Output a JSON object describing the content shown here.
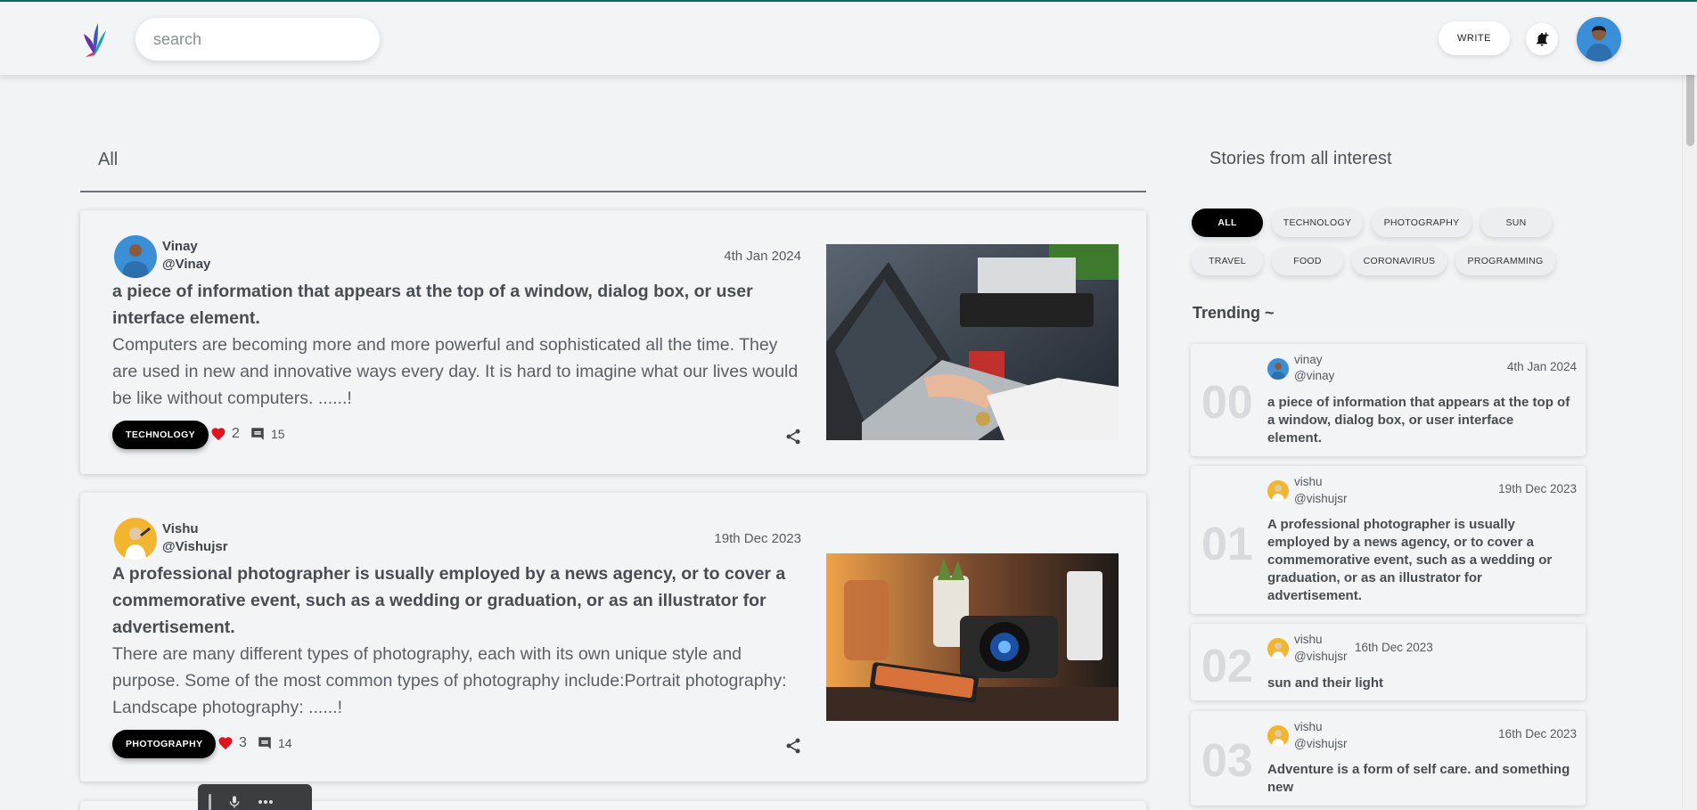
{
  "header": {
    "search_placeholder": "search",
    "write_label": "WRITE"
  },
  "feed": {
    "tab_label": "All",
    "posts": [
      {
        "author_name": "Vinay",
        "author_handle": "@Vinay",
        "date": "4th Jan 2024",
        "title": "a piece of information that appears at the top of a window, dialog box, or user interface element.",
        "excerpt": "Computers are becoming more and more powerful and sophisticated all the time. They are used in new and innovative ways every day. It is hard to imagine what our lives would be like without computers. ......!",
        "tag": "TECHNOLOGY",
        "likes": "2",
        "comments": "15"
      },
      {
        "author_name": "Vishu",
        "author_handle": "@Vishujsr",
        "date": "19th Dec 2023",
        "title": "A professional photographer is usually employed by a news agency, or to cover a commemorative event, such as a wedding or graduation, or as an illustrator for advertisement.",
        "excerpt": "There are many different types of photography, each with its own unique style and purpose. Some of the most common types of photography include:Portrait photography: Landscape photography: ......!",
        "tag": "PHOTOGRAPHY",
        "likes": "3",
        "comments": "14"
      }
    ]
  },
  "sidebar": {
    "title": "Stories from all interest",
    "chips": [
      "ALL",
      "TECHNOLOGY",
      "PHOTOGRAPHY",
      "SUN",
      "TRAVEL",
      "FOOD",
      "CORONAVIRUS",
      "PROGRAMMING"
    ],
    "active_chip": "ALL",
    "trending_label": "Trending ~",
    "trending": [
      {
        "rank": "00",
        "name": "vinay",
        "handle": "@vinay",
        "date": "4th Jan 2024",
        "title": "a piece of information that appears at the top of a window, dialog box, or user interface element."
      },
      {
        "rank": "01",
        "name": "vishu",
        "handle": "@vishujsr",
        "date": "19th Dec 2023",
        "title": "A professional photographer is usually employed by a news agency, or to cover a commemorative event, such as a wedding or graduation, or as an illustrator for advertisement."
      },
      {
        "rank": "02",
        "name": "vishu",
        "handle": "@vishujsr",
        "date": "16th Dec 2023",
        "title": "sun and their light"
      },
      {
        "rank": "03",
        "name": "vishu",
        "handle": "@vishujsr",
        "date": "16th Dec 2023",
        "title": "Adventure is a form of self care. and something new"
      }
    ]
  },
  "colors": {
    "accent_top_border": "#0e6b6b",
    "tag_background": "#000000",
    "heart": "#e0141e",
    "page_background": "#f2f3f5"
  },
  "icons": [
    "logo-icon",
    "bell-plus-icon",
    "heart-icon",
    "comment-icon",
    "share-icon",
    "mic-icon",
    "more-icon"
  ]
}
